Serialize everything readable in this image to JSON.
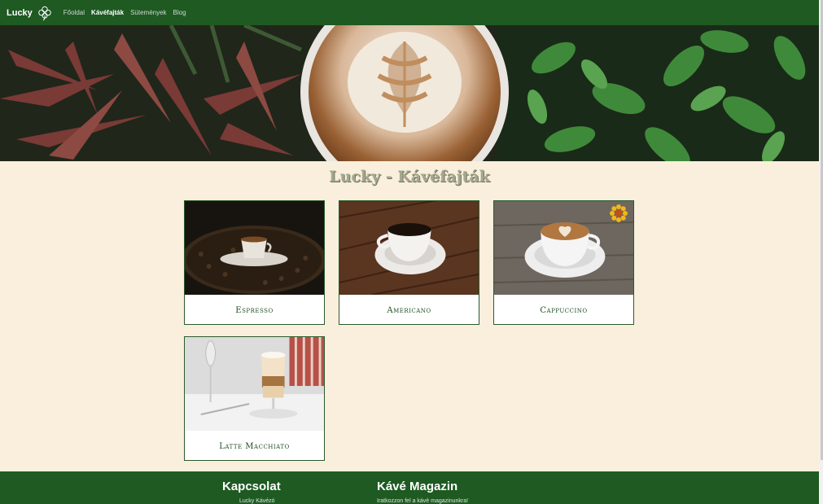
{
  "nav": {
    "brand": "Lucky",
    "links": [
      {
        "label": "Főoldal",
        "active": false
      },
      {
        "label": "Kávéfajták",
        "active": true
      },
      {
        "label": "Sütemények",
        "active": false
      },
      {
        "label": "Blog",
        "active": false
      }
    ]
  },
  "page": {
    "title": "Lucky - Kávéfajták"
  },
  "cards": [
    {
      "label": "Espresso"
    },
    {
      "label": "Americano"
    },
    {
      "label": "Cappuccino"
    },
    {
      "label": "Latte Macchiato"
    }
  ],
  "footer": {
    "contact_title": "Kapcsolat",
    "contact_line": "Lucky Kávézó",
    "magazine_title": "Kávé Magazin",
    "magazine_text": "Iratkozzon fel a kávé magazinunkra!"
  },
  "colors": {
    "nav_bg": "#1e5a22",
    "page_bg": "#faefdc",
    "card_border": "#2a5b2c"
  }
}
